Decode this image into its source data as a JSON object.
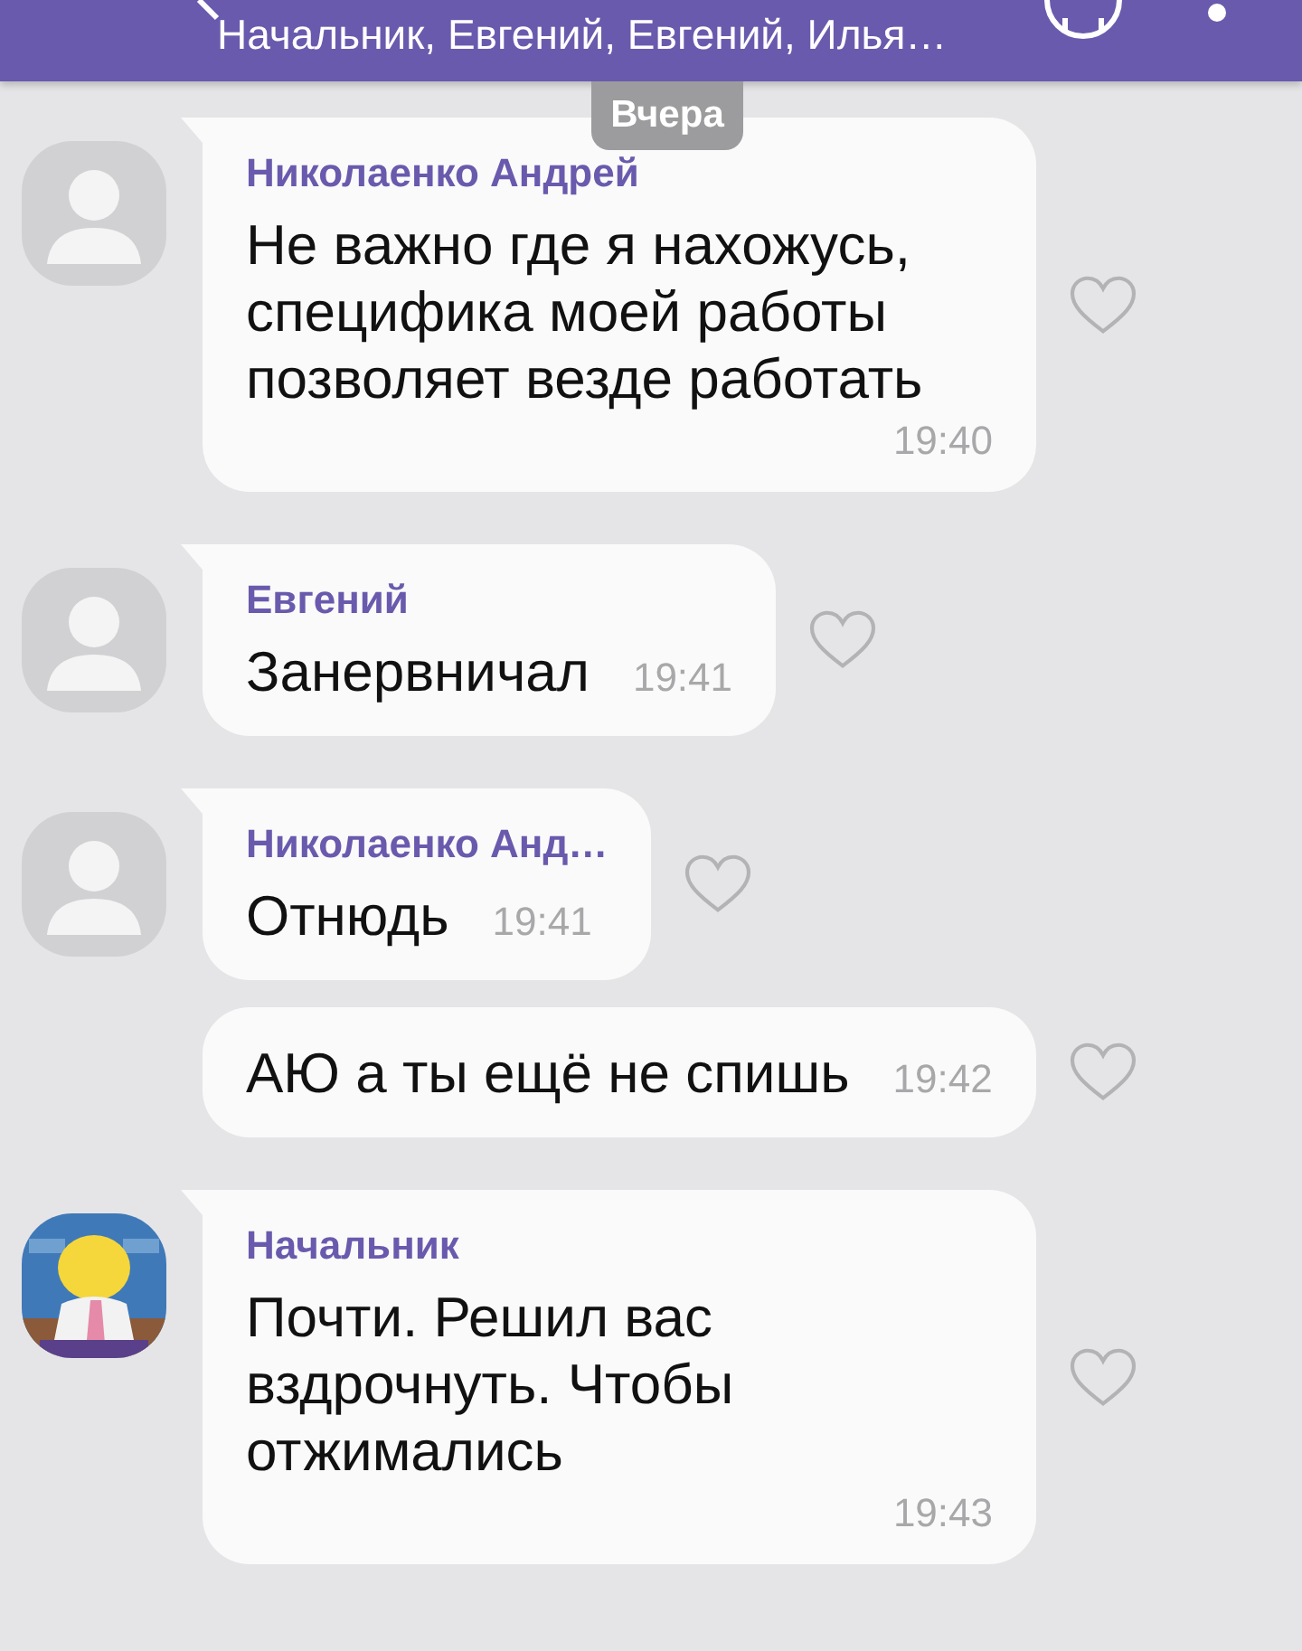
{
  "header": {
    "subtitle": "Начальник, Евгений, Евгений, Илья…"
  },
  "date_divider": "Вчера",
  "messages": [
    {
      "kind": "placeholder",
      "sender": "Николаенко Андрей",
      "text": "Не важно где я нахожусь, специфика моей работы позволяет везде работать",
      "time": "19:40",
      "liked": false
    },
    {
      "kind": "placeholder",
      "sender": "Евгений",
      "text": "Занервничал",
      "time": "19:41",
      "liked": false
    },
    {
      "kind": "placeholder",
      "sender": "Николаенко Анд…",
      "text": "Отнюдь",
      "time": "19:41",
      "liked": false
    },
    {
      "kind": "continuation",
      "text": "АЮ а ты ещё не спишь",
      "time": "19:42",
      "liked": false
    },
    {
      "kind": "picture",
      "sender": "Начальник",
      "text": "Почти. Решил вас вздрочнуть. Чтобы отжимались",
      "time": "19:43",
      "liked": false
    }
  ]
}
